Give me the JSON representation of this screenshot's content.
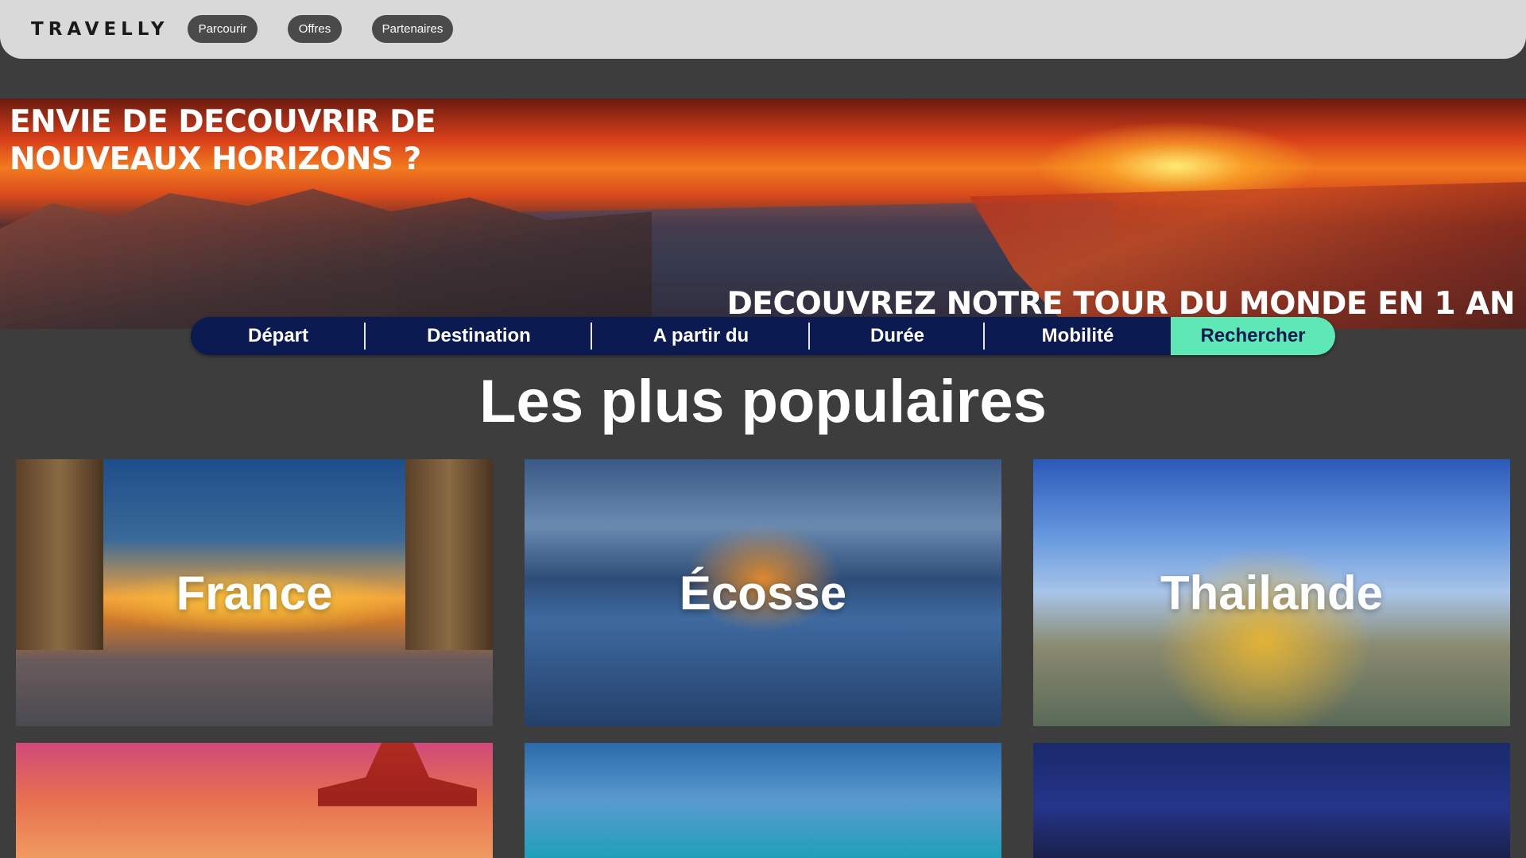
{
  "header": {
    "logo": "TRAVELLY",
    "nav": [
      {
        "label": "Parcourir"
      },
      {
        "label": "Offres"
      },
      {
        "label": "Partenaires"
      }
    ]
  },
  "hero": {
    "title_line1": "ENVIE DE DECOUVRIR DE",
    "title_line2": "NOUVEAUX HORIZONS ?",
    "subtitle": "DECOUVREZ NOTRE TOUR DU MONDE EN 1 AN"
  },
  "search_bar": {
    "depart": "Départ",
    "destination": "Destination",
    "a_partir_du": "A partir du",
    "duree": "Durée",
    "mobilite": "Mobilité",
    "search_button": "Rechercher",
    "accent_color": "#5ee8b5",
    "bar_color": "#0c1a52"
  },
  "popular": {
    "title": "Les plus populaires",
    "destinations": [
      {
        "label": "France"
      },
      {
        "label": "Écosse"
      },
      {
        "label": "Thailande"
      }
    ]
  }
}
